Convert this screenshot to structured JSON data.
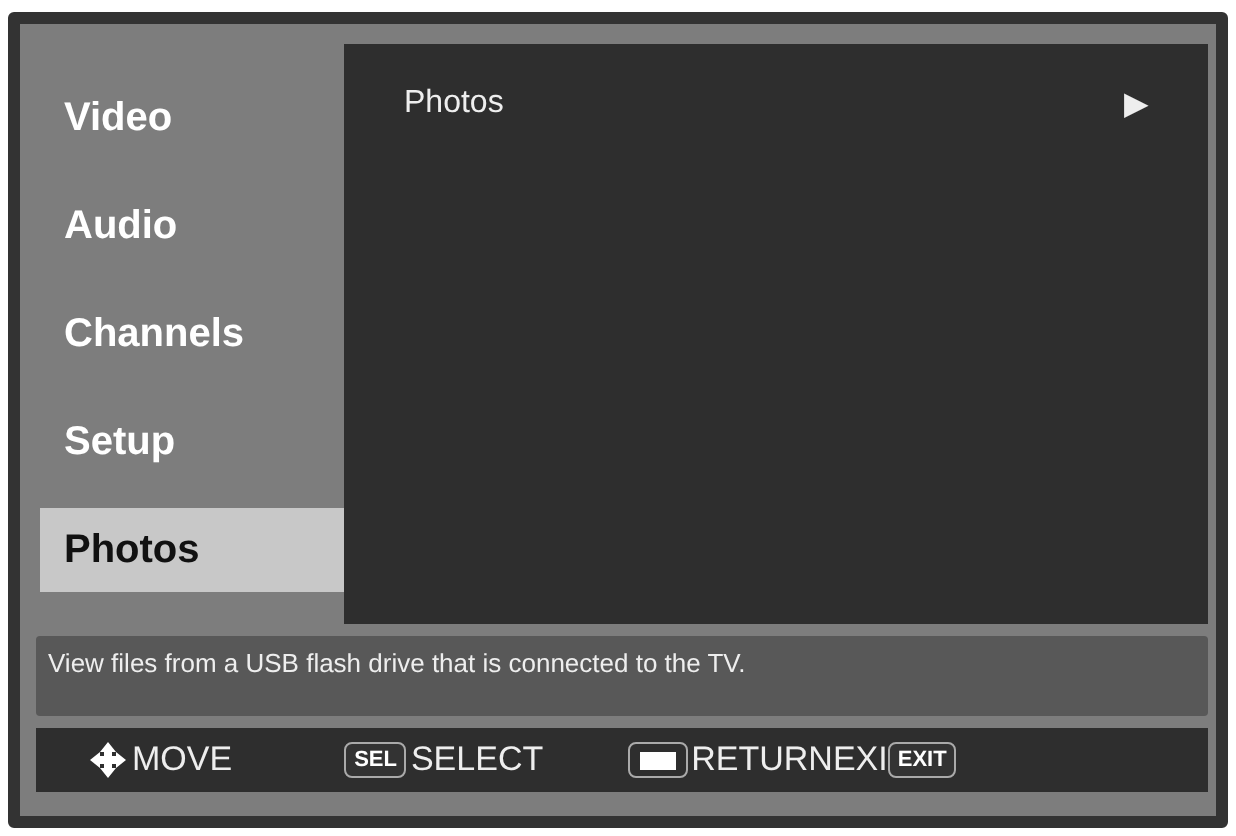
{
  "sidebar": {
    "items": [
      {
        "label": "Video",
        "selected": false
      },
      {
        "label": "Audio",
        "selected": false
      },
      {
        "label": "Channels",
        "selected": false
      },
      {
        "label": "Setup",
        "selected": false
      },
      {
        "label": "Photos",
        "selected": true
      }
    ]
  },
  "content": {
    "items": [
      {
        "label": "Photos",
        "arrow": "▶"
      }
    ]
  },
  "description": "View files from a USB flash drive that is connected to the TV.",
  "hints": [
    {
      "kind": "move",
      "label": "MOVE"
    },
    {
      "kind": "key",
      "key": "SEL",
      "label": "SELECT"
    },
    {
      "kind": "blank",
      "label": "RETURN"
    },
    {
      "kind": "plain",
      "label": "EXI"
    },
    {
      "kind": "keyonly",
      "key": "EXIT"
    }
  ]
}
